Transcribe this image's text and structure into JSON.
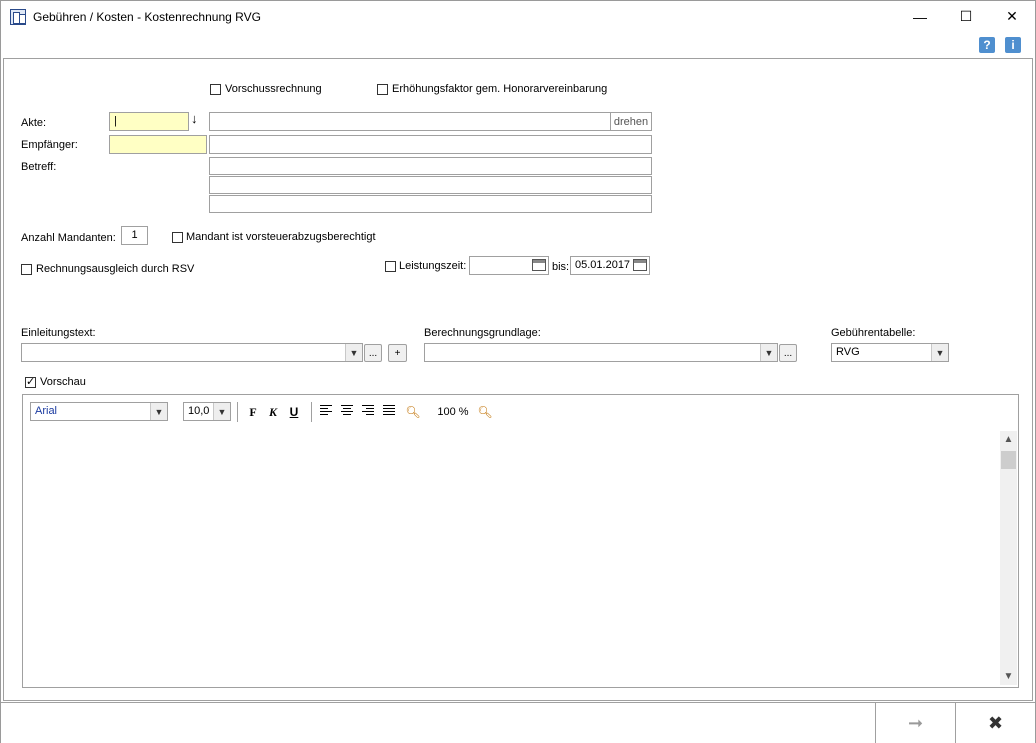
{
  "window": {
    "title": "Gebühren / Kosten - Kostenrechnung RVG",
    "minimize": "—",
    "maximize": "☐",
    "close": "✕"
  },
  "help": {
    "help_label": "?",
    "info_label": "i"
  },
  "options": {
    "vorschuss": "Vorschussrechnung",
    "erhoehung": "Erhöhungsfaktor gem. Honorarvereinbarung"
  },
  "form": {
    "akte_label": "Akte:",
    "akte_value": "|",
    "akte_arrow": "↓",
    "akte_name": "",
    "drehen_label": "drehen",
    "empfaenger_label": "Empfänger:",
    "empfaenger_value": "",
    "empfaenger_name": "",
    "betreff_label": "Betreff:",
    "betreff_lines": [
      "",
      "",
      ""
    ],
    "anzahl_label": "Anzahl Mandanten:",
    "anzahl_value": "1",
    "vorsteuer_label": "Mandant ist vorsteuerabzugsberechtigt",
    "rsv_label": "Rechnungsausgleich durch RSV",
    "leistung_label": "Leistungszeit:",
    "leistung_from": "",
    "bis_label": "bis:",
    "leistung_to": "05.01.2017"
  },
  "texts": {
    "einleitung_label": "Einleitungstext:",
    "einleitung_value": "",
    "dots_label": "...",
    "plus_label": "+",
    "berechnung_label": "Berechnungsgrundlage:",
    "berechnung_value": "",
    "tabelle_label": "Gebührentabelle:",
    "tabelle_value": "RVG"
  },
  "preview": {
    "vorschau_label": "Vorschau",
    "font": "Arial",
    "size": "10,0",
    "bold": "F",
    "italic": "K",
    "underline": "U",
    "zoom": "100 %"
  },
  "footer": {
    "next_label": "➞",
    "cancel_label": "✖"
  },
  "colors": {
    "field_yellow": "#ffffc4",
    "help_blue": "#4f8fcf"
  }
}
